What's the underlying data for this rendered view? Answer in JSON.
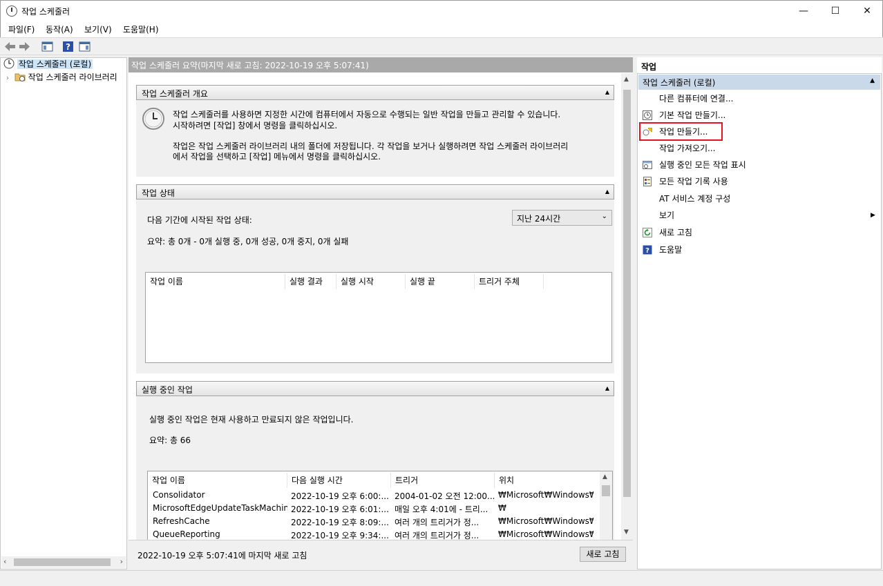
{
  "window": {
    "title": "작업 스케줄러"
  },
  "menu": [
    "파일(F)",
    "동작(A)",
    "보기(V)",
    "도움말(H)"
  ],
  "tree": {
    "root": "작업 스케줄러 (로컬)",
    "child": "작업 스케줄러 라이브러리"
  },
  "center": {
    "header": "작업 스케줄러 요약(마지막 새로 고침: 2022-10-19 오후 5:07:41)",
    "overview": {
      "title": "작업 스케줄러 개요",
      "line1": "작업 스케줄러를 사용하면 지정한 시간에 컴퓨터에서 자동으로 수행되는 일반 작업을 만들고 관리할 수 있습니다.",
      "line2": "시작하려면 [작업] 창에서 명령을 클릭하십시오.",
      "line3": "작업은 작업 스케줄러 라이브러리 내의 폴더에 저장됩니다. 각 작업을 보거나 실행하려면 작업 스케줄러 라이브러리",
      "line4": "에서 작업을 선택하고 [작업] 메뉴에서 명령을 클릭하십시오."
    },
    "status": {
      "title": "작업 상태",
      "period_label": "다음 기간에 시작된 작업 상태:",
      "period_value": "지난 24시간",
      "summary": "요약: 총 0개 - 0개 실행 중, 0개 성공, 0개 중지, 0개 실패",
      "columns": [
        "작업 이름",
        "실행 결과",
        "실행 시작",
        "실행 끝",
        "트리거 주체"
      ]
    },
    "running": {
      "title": "실행 중인 작업",
      "desc": "실행 중인 작업은 현재 사용하고 만료되지 않은 작업입니다.",
      "summary": "요약: 총 66",
      "columns": [
        "작업 이름",
        "다음 실행 시간",
        "트리거",
        "위치"
      ],
      "rows": [
        [
          "Consolidator",
          "2022-10-19 오후 6:00:...",
          "2004-01-02 오전 12:00...",
          "₩Microsoft₩Windows₩..."
        ],
        [
          "MicrosoftEdgeUpdateTaskMachin...",
          "2022-10-19 오후 6:01:...",
          "매일 오후 4:01에 - 트리...",
          "₩"
        ],
        [
          "RefreshCache",
          "2022-10-19 오후 8:09:...",
          "여러 개의 트리거가 정...",
          "₩Microsoft₩Windows₩..."
        ],
        [
          "QueueReporting",
          "2022-10-19 오후 9:34:...",
          "여러 개의 트리거가 정...",
          "₩Microsoft₩Windows₩..."
        ]
      ]
    },
    "footer": {
      "last_refresh": "2022-10-19 오후 5:07:41에 마지막 새로 고침",
      "refresh_button": "새로 고침"
    }
  },
  "actions": {
    "title": "작업",
    "group": "작업 스케줄러 (로컬)",
    "items": [
      "다른 컴퓨터에 연결...",
      "기본 작업 만들기...",
      "작업 만들기...",
      "작업 가져오기...",
      "실행 중인 모든 작업 표시",
      "모든 작업 기록 사용",
      "AT 서비스 계정 구성",
      "보기",
      "새로 고침",
      "도움말"
    ]
  },
  "colors": {
    "highlight": "#e81123",
    "group_bg": "#c9d9ea",
    "header_gray": "#a9a9a9"
  }
}
